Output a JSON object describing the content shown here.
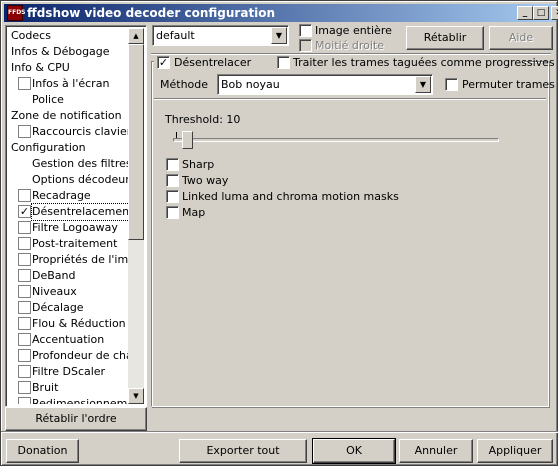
{
  "window": {
    "title": "ffdshow video decoder configuration",
    "icon_label": "FFDS",
    "minimize_glyph": "_",
    "maximize_glyph": "□",
    "close_glyph": "✕"
  },
  "tree": {
    "items": [
      {
        "label": "Codecs",
        "indent": 0,
        "checkbox": false
      },
      {
        "label": "Infos & Débogage",
        "indent": 0,
        "checkbox": false
      },
      {
        "label": "Info & CPU",
        "indent": 0,
        "checkbox": false
      },
      {
        "label": "Infos à l'écran",
        "indent": 1,
        "checkbox": true,
        "checked": false
      },
      {
        "label": "Police",
        "indent": 1,
        "checkbox": false
      },
      {
        "label": "Zone de notification",
        "indent": 0,
        "checkbox": false
      },
      {
        "label": "Raccourcis clavier",
        "indent": 1,
        "checkbox": true,
        "checked": false
      },
      {
        "label": "Configuration",
        "indent": 0,
        "checkbox": false
      },
      {
        "label": "Gestion des filtres",
        "indent": 1,
        "checkbox": false
      },
      {
        "label": "Options décodeur",
        "indent": 1,
        "checkbox": false
      },
      {
        "label": "Recadrage",
        "indent": 1,
        "checkbox": true,
        "checked": false
      },
      {
        "label": "Désentrelacement",
        "indent": 1,
        "checkbox": true,
        "checked": true,
        "selected": true
      },
      {
        "label": "Filtre Logoaway",
        "indent": 1,
        "checkbox": true,
        "checked": false
      },
      {
        "label": "Post-traitement",
        "indent": 1,
        "checkbox": true,
        "checked": false
      },
      {
        "label": "Propriétés de l'image",
        "indent": 1,
        "checkbox": true,
        "checked": false
      },
      {
        "label": "DeBand",
        "indent": 1,
        "checkbox": true,
        "checked": false
      },
      {
        "label": "Niveaux",
        "indent": 1,
        "checkbox": true,
        "checked": false
      },
      {
        "label": "Décalage",
        "indent": 1,
        "checkbox": true,
        "checked": false
      },
      {
        "label": "Flou & Réduction de bruit",
        "indent": 1,
        "checkbox": true,
        "checked": false
      },
      {
        "label": "Accentuation",
        "indent": 1,
        "checkbox": true,
        "checked": false
      },
      {
        "label": "Profondeur de champ",
        "indent": 1,
        "checkbox": true,
        "checked": false
      },
      {
        "label": "Filtre DScaler",
        "indent": 1,
        "checkbox": true,
        "checked": false
      },
      {
        "label": "Bruit",
        "indent": 1,
        "checkbox": true,
        "checked": false
      },
      {
        "label": "Redimensionnement",
        "indent": 1,
        "checkbox": true,
        "checked": false
      }
    ],
    "reset_order_label": "Rétablir l'ordre",
    "scroll_up_glyph": "▲",
    "scroll_down_glyph": "▼"
  },
  "preset": {
    "value": "default",
    "full_image_label": "Image entière",
    "half_label": "Moitié droite",
    "reset_label": "Rétablir",
    "help_label": "Aide"
  },
  "deinterlace": {
    "enable_label": "Désentrelacer",
    "enabled": true,
    "progressive_label": "Traiter les trames taguées comme progressives",
    "method_label": "Méthode",
    "method_value": "Bob noyau",
    "swap_fields_label": "Permuter trames",
    "threshold_label": "Threshold: 10",
    "threshold_value": 10,
    "options": [
      {
        "label": "Sharp",
        "checked": false
      },
      {
        "label": "Two way",
        "checked": false
      },
      {
        "label": "Linked luma and chroma motion masks",
        "checked": false
      },
      {
        "label": "Map",
        "checked": false
      }
    ]
  },
  "footer": {
    "donation": "Donation",
    "export_all": "Exporter tout",
    "ok": "OK",
    "cancel": "Annuler",
    "apply": "Appliquer"
  },
  "glyphs": {
    "check": "✓",
    "dropdown": "▼"
  }
}
